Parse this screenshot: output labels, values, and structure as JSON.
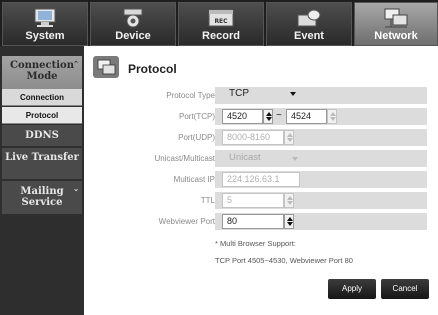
{
  "top_tabs": [
    {
      "label": "System",
      "icon": "monitor-icon"
    },
    {
      "label": "Device",
      "icon": "camera-icon"
    },
    {
      "label": "Record",
      "icon": "rec-icon"
    },
    {
      "label": "Event",
      "icon": "event-icon"
    },
    {
      "label": "Network",
      "icon": "network-icon"
    }
  ],
  "sidebar": {
    "connection_mode": "Connection Mode",
    "connection": "Connection",
    "protocol": "Protocol",
    "ddns": "DDNS",
    "live_transfer": "Live Transfer",
    "mailing_service": "Mailing Service"
  },
  "page": {
    "title": "Protocol"
  },
  "form": {
    "protocol_type": {
      "label": "Protocol Type",
      "value": "TCP"
    },
    "port_tcp": {
      "label": "Port(TCP)",
      "from": "4520",
      "separator": "~",
      "to": "4524"
    },
    "port_udp": {
      "label": "Port(UDP)",
      "value": "8000-8160"
    },
    "unicast_multicast": {
      "label": "Unicast/Multicast",
      "value": "Unicast"
    },
    "multicast_ip": {
      "label": "Multicast IP",
      "value": "224.126.63.1"
    },
    "ttl": {
      "label": "TTL",
      "value": "5"
    },
    "webviewer_port": {
      "label": "Webviewer Port",
      "value": "80"
    }
  },
  "notes": {
    "line1": "* Multi Browser Support:",
    "line2": "TCP Port 4505~4530, Webviewer Port 80"
  },
  "buttons": {
    "apply": "Apply",
    "cancel": "Cancel"
  },
  "colors": {
    "active_tab": "#8f8f8f",
    "topbar": "#1f1f1f",
    "button": "#222222"
  }
}
